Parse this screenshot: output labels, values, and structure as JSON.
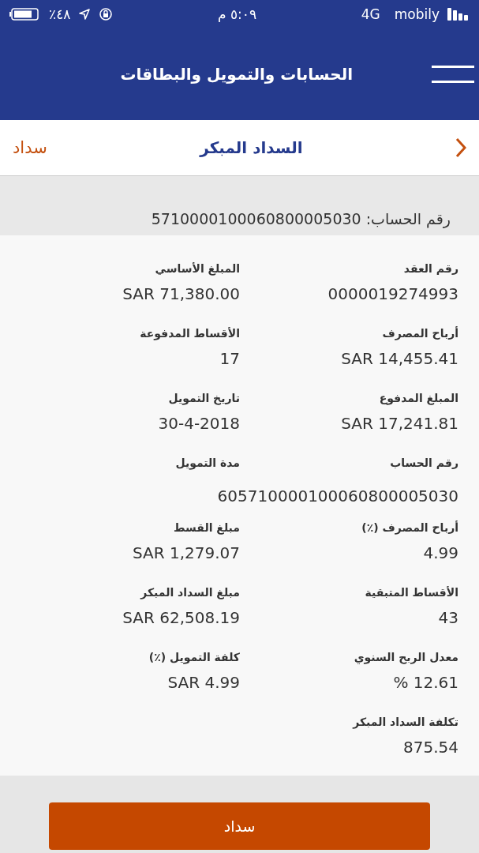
{
  "status_bar": {
    "battery": "٪٤٨",
    "time": "٥:٠٩ م",
    "network": "4G",
    "carrier": "mobily"
  },
  "header": {
    "title": "الحسابات والتمويل والبطاقات"
  },
  "nav": {
    "title": "السداد المبكر",
    "action": "سداد"
  },
  "account_line": "رقم الحساب: 5710000100060800005030",
  "rows": [
    {
      "cells": [
        {
          "label": "رقم العقد",
          "value": "0000019274993"
        },
        {
          "label": "المبلغ الأساسي",
          "value": "SAR 71,380.00"
        }
      ]
    },
    {
      "cells": [
        {
          "label": "أرباح المصرف",
          "value": "SAR 14,455.41"
        },
        {
          "label": "الأقساط المدفوعة",
          "value": "17"
        }
      ]
    },
    {
      "cells": [
        {
          "label": "المبلغ المدفوع",
          "value": "SAR 17,241.81"
        },
        {
          "label": "تاريخ التمويل",
          "value": "30-4-2018"
        }
      ]
    },
    {
      "cells": [
        {
          "label": "رقم الحساب"
        },
        {
          "label": "مدة التمويل"
        }
      ],
      "wide_value": "605710000100060800005030"
    },
    {
      "cells": [
        {
          "label": "أرباح المصرف (٪)",
          "value": "4.99"
        },
        {
          "label": "مبلغ القسط",
          "value": "SAR 1,279.07"
        }
      ]
    },
    {
      "cells": [
        {
          "label": "الأقساط المتبقية",
          "value": "43"
        },
        {
          "label": "مبلغ السداد المبكر",
          "value": "SAR 62,508.19"
        }
      ]
    },
    {
      "cells": [
        {
          "label": "معدل الربح السنوي",
          "value": "% 12.61"
        },
        {
          "label": "كلفة التمويل (٪)",
          "value": "SAR 4.99"
        }
      ]
    },
    {
      "cells": [
        {
          "label": "تكلفة السداد المبكر",
          "value": "875.54"
        }
      ]
    }
  ],
  "pay_button": "سداد"
}
